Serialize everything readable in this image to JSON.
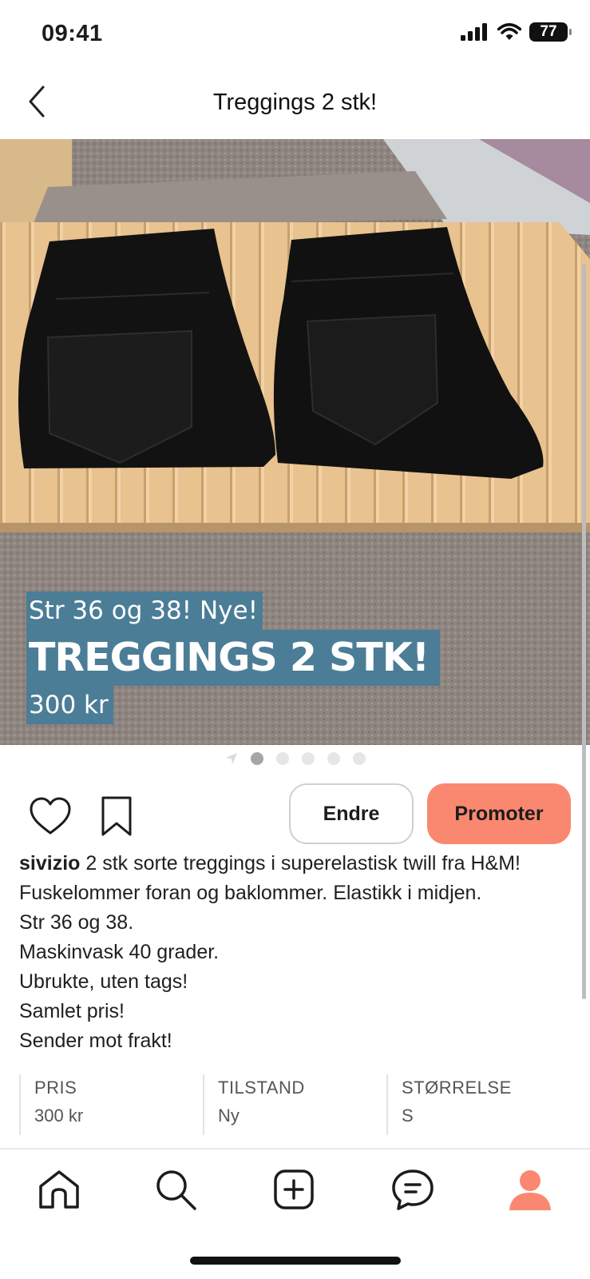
{
  "status_bar": {
    "time": "09:41",
    "battery": "77",
    "icons": [
      "signal-icon",
      "wifi-icon",
      "battery-icon"
    ]
  },
  "header": {
    "title": "Treggings 2 stk!",
    "back_icon": "chevron-left-icon"
  },
  "listing_image": {
    "overlay_line_1": "Str 36 og 38! Nye!",
    "overlay_line_2": "TREGGINGS 2 STK!",
    "overlay_line_3": "300 kr",
    "overlay_color": "#4b7d96",
    "page_count": 5,
    "active_page": 1
  },
  "actions": {
    "like_icon": "heart-icon",
    "save_icon": "bookmark-icon",
    "edit_label": "Endre",
    "promote_label": "Promoter",
    "promote_color": "#fa8870"
  },
  "description": {
    "username": "sivizio",
    "line_1": " 2 stk sorte treggings i superelastisk twill fra H&M!",
    "line_2": "Fuskelommer foran og baklommer. Elastikk i midjen.",
    "line_3": "Str 36 og 38.",
    "line_4": "Maskinvask 40 grader.",
    "line_5": "Ubrukte, uten tags!",
    "line_6": "Samlet pris!",
    "line_7": "Sender mot frakt!"
  },
  "details": [
    {
      "label": "PRIS",
      "value": "300 kr"
    },
    {
      "label": "TILSTAND",
      "value": "Ny"
    },
    {
      "label": "STØRRELSE",
      "value": "S"
    }
  ],
  "tabbar": {
    "items": [
      "home-icon",
      "search-icon",
      "add-icon",
      "chat-icon",
      "profile-icon"
    ],
    "active_color": "#fa8870"
  }
}
